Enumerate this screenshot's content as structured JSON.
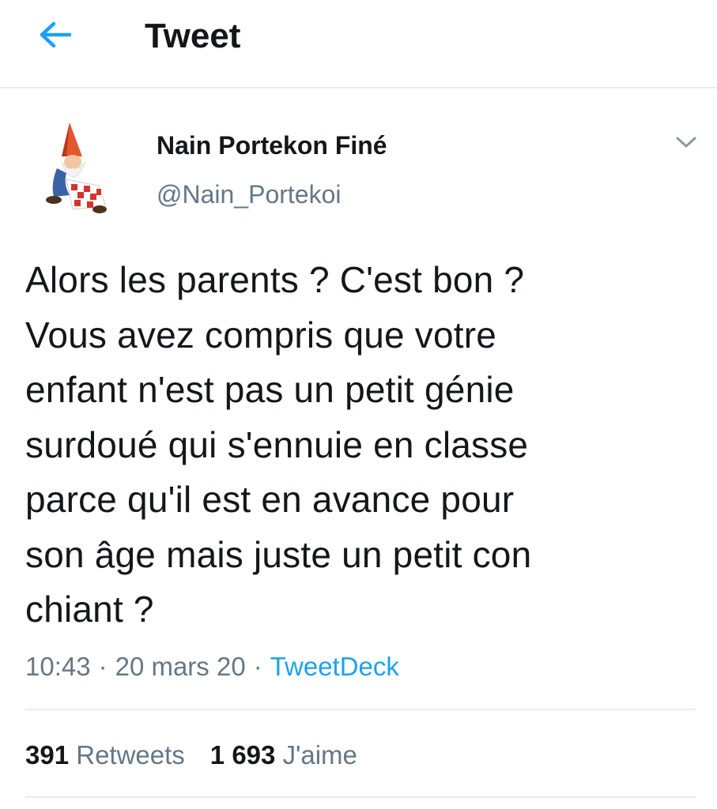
{
  "header": {
    "back_icon": "arrow-left-icon",
    "title": "Tweet",
    "accent_color": "#1da1f2"
  },
  "tweet": {
    "author": {
      "avatar_icon": "garden-gnome-avatar",
      "name": "Nain Portekon Finé",
      "handle": "@Nain_Portekoi"
    },
    "more_icon": "chevron-down-icon",
    "text": "Alors les parents ? C'est bon ?\nVous avez compris que votre\nenfant n'est pas un petit génie\nsurdoué qui s'ennuie en classe\nparce qu'il est en avance pour\nson âge mais juste un petit con\nchiant ?",
    "time": "10:43",
    "date": "20 mars 20",
    "separator": "·",
    "source": "TweetDeck",
    "stats": {
      "retweets_count": "391",
      "retweets_label": "Retweets",
      "likes_count": "1 693",
      "likes_label": "J'aime"
    }
  }
}
